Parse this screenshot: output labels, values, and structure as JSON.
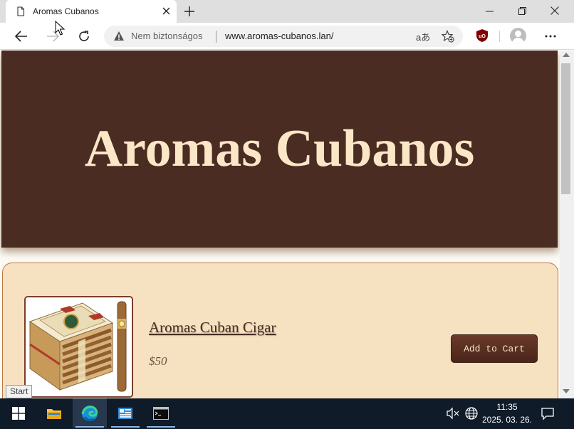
{
  "browser": {
    "tab": {
      "title": "Aromas Cubanos",
      "icon": "page-icon",
      "close_icon": "close-icon"
    },
    "new_tab_icon": "plus-icon",
    "window_controls": {
      "minimize": "minimize-icon",
      "maximize": "restore-icon",
      "close": "close-icon"
    },
    "nav": {
      "back": "back-arrow-icon",
      "forward": "forward-arrow-icon",
      "reload": "reload-icon"
    },
    "address": {
      "security_label": "Nem biztonságos",
      "url": "www.aromas-cubanos.lan/",
      "read_aloud": "aあ"
    },
    "toolbar_icons": [
      "read-aloud-icon",
      "add-favorite-icon",
      "ublock-origin-icon",
      "profile-avatar-icon",
      "more-menu-icon"
    ]
  },
  "page": {
    "hero_title": "Aromas Cubanos",
    "product": {
      "name": "Aromas Cuban Cigar",
      "price": "$50",
      "add_to_cart_label": "Add to Cart",
      "image": "cigar-box-image"
    }
  },
  "tooltip": "Start",
  "taskbar": {
    "apps": [
      "windows-start-icon",
      "file-explorer-icon",
      "edge-icon",
      "server-manager-icon",
      "command-prompt-icon"
    ],
    "active_app": "edge-icon",
    "time": "11:35",
    "date": "2025. 03. 26.",
    "tray": [
      "volume-muted-icon",
      "network-globe-icon",
      "notification-icon"
    ]
  },
  "colors": {
    "hero_bg": "#4a2c22",
    "hero_text": "#fbe7c7",
    "card_bg": "#f6e2c1",
    "card_border": "#b97a46",
    "button_bg": "#5a2f20",
    "taskbar_bg": "#0f1b29"
  }
}
